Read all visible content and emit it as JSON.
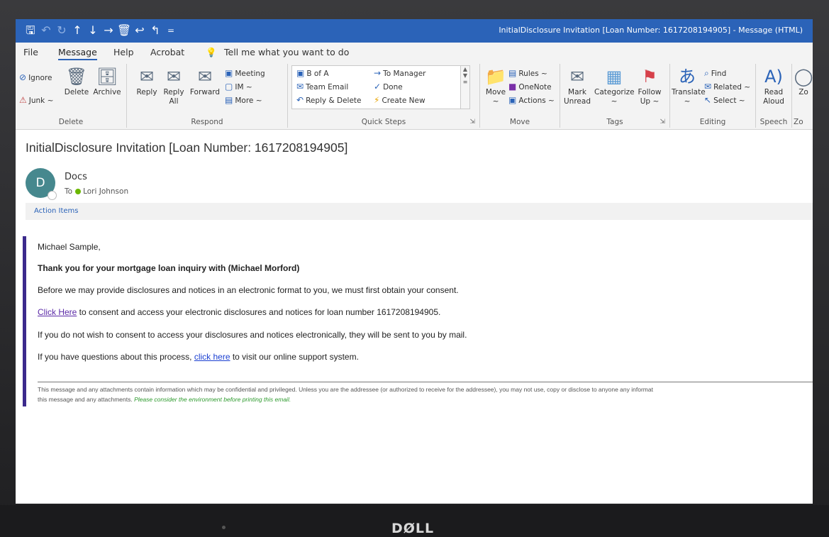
{
  "window": {
    "title": "InitialDisclosure Invitation [Loan Number: 1617208194905]  -  Message (HTML)",
    "quick_access": [
      "save-icon",
      "undo-icon",
      "redo-icon",
      "up-arrow-icon",
      "down-arrow-icon",
      "right-arrow-icon",
      "delete-icon",
      "reply-all-icon",
      "reply-icon",
      "customize-icon"
    ]
  },
  "menu": {
    "file": "File",
    "message": "Message",
    "help": "Help",
    "acrobat": "Acrobat",
    "tell_me": "Tell me what you want to do"
  },
  "ribbon": {
    "delete_group": {
      "label": "Delete",
      "ignore": "Ignore",
      "junk": "Junk ~",
      "delete": "Delete",
      "archive": "Archive"
    },
    "respond_group": {
      "label": "Respond",
      "reply": "Reply",
      "reply_all_1": "Reply",
      "reply_all_2": "All",
      "forward": "Forward",
      "meeting": "Meeting",
      "im": "IM ~",
      "more": "More ~"
    },
    "quicksteps_group": {
      "label": "Quick Steps",
      "items": [
        "B of A",
        "Team Email",
        "Reply & Delete",
        "To Manager",
        "Done",
        "Create New"
      ]
    },
    "move_group": {
      "label": "Move",
      "move_1": "Move",
      "move_2": "~",
      "rules": "Rules ~",
      "onenote": "OneNote",
      "actions": "Actions ~"
    },
    "tags_group": {
      "label": "Tags",
      "mark_1": "Mark",
      "mark_2": "Unread",
      "categorize_1": "Categorize",
      "categorize_2": "~",
      "follow_1": "Follow",
      "follow_2": "Up ~"
    },
    "editing_group": {
      "label": "Editing",
      "translate_1": "Translate",
      "translate_2": "~",
      "find": "Find",
      "related": "Related ~",
      "select": "Select ~"
    },
    "speech_group": {
      "label": "Speech",
      "read_1": "Read",
      "read_2": "Aloud"
    },
    "zoom_group": {
      "label": "Zo",
      "zoom": "Zo"
    }
  },
  "message": {
    "subject": "InitialDisclosure Invitation [Loan Number: 1617208194905]",
    "avatar_letter": "D",
    "sender": "Docs",
    "to_label": "To",
    "recipient": "Lori Johnson",
    "action_items": "Action Items"
  },
  "body": {
    "greeting": "Michael Sample,",
    "thanks": "Thank you for your mortgage loan inquiry with (Michael Morford)",
    "consent_intro": "Before we may provide disclosures and notices in an electronic format to you, we must first obtain your consent.",
    "click_here": "Click Here",
    "consent_rest": " to consent and access your electronic disclosures and notices for loan number 1617208194905.",
    "mail_note": "If you do not wish to consent to access your disclosures and notices electronically, they will be sent to you by mail.",
    "questions_pre": "If you have questions about this process, ",
    "click_here_2": "click here",
    "questions_post": " to visit our online support system.",
    "disclaimer_1": "This message and any attachments contain information which may be confidential and privileged. Unless you are the addressee (or authorized to receive for the addressee), you may not use, copy or disclose to anyone any informat",
    "disclaimer_2": "this message and any attachments. ",
    "disclaimer_green": "Please consider the environment before printing this email."
  },
  "device": {
    "brand": "DØLL"
  },
  "colors": {
    "titlebar": "#2b63b8",
    "avatar": "#46888e",
    "link": "#5b2aa7",
    "link_blue": "#1a3fd1",
    "accent_bar": "#3c2a8c",
    "green_note": "#2d9a2d"
  }
}
